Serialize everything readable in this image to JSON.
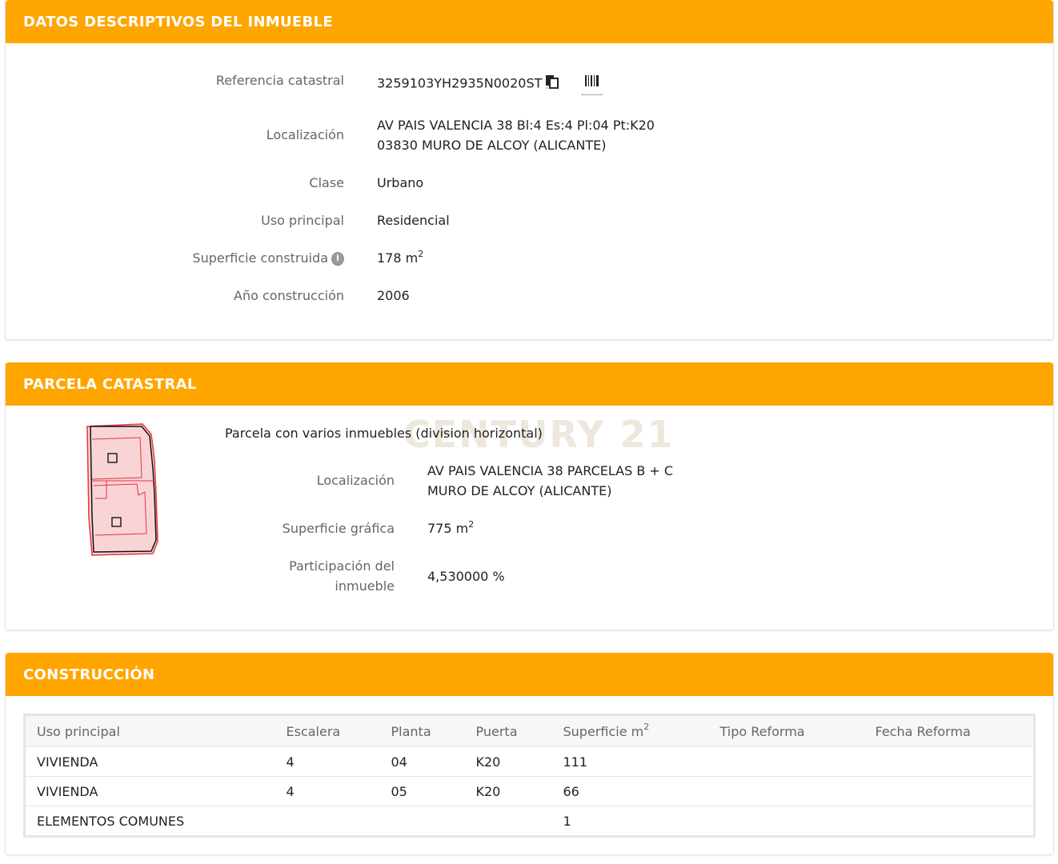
{
  "datos": {
    "title": "DATOS DESCRIPTIVOS DEL INMUEBLE",
    "referencia": {
      "label": "Referencia catastral",
      "value": "3259103YH2935N0020ST",
      "copy_icon": "copy-icon",
      "barcode_icon": "barcode-icon"
    },
    "localizacion": {
      "label": "Localización",
      "line1": "AV PAIS VALENCIA 38 Bl:4 Es:4 Pl:04 Pt:K20",
      "line2": "03830 MURO DE ALCOY (ALICANTE)"
    },
    "clase": {
      "label": "Clase",
      "value": "Urbano"
    },
    "uso": {
      "label": "Uso principal",
      "value": "Residencial"
    },
    "superficie": {
      "label": "Superficie construida",
      "value": "178 m",
      "unit_exp": "2",
      "info_icon": "info-icon"
    },
    "anio": {
      "label": "Año construcción",
      "value": "2006"
    }
  },
  "parcela": {
    "title": "PARCELA CATASTRAL",
    "subtitle": "Parcela con varios inmuebles (division horizontal)",
    "watermark": "CENTURY 21",
    "localizacion": {
      "label": "Localización",
      "line1": "AV PAIS VALENCIA 38 PARCELAS B + C",
      "line2": "MURO DE ALCOY (ALICANTE)"
    },
    "superficie": {
      "label": "Superficie gráfica",
      "value": "775 m",
      "unit_exp": "2"
    },
    "participacion": {
      "label_line1": "Participación del",
      "label_line2": "inmueble",
      "value": "4,530000 %"
    },
    "colors": {
      "outline": "#e8323c",
      "fill": "#f9d4d6"
    }
  },
  "construccion": {
    "title": "CONSTRUCCIÓN",
    "headers": [
      "Uso principal",
      "Escalera",
      "Planta",
      "Puerta",
      "Superficie m",
      "Tipo Reforma",
      "Fecha Reforma"
    ],
    "header_sup": "2",
    "rows": [
      [
        "VIVIENDA",
        "4",
        "04",
        "K20",
        "111",
        "",
        ""
      ],
      [
        "VIVIENDA",
        "4",
        "05",
        "K20",
        "66",
        "",
        ""
      ],
      [
        "ELEMENTOS COMUNES",
        "",
        "",
        "",
        "1",
        "",
        ""
      ]
    ]
  },
  "colors": {
    "accent": "#FFA500",
    "label_text": "#666666",
    "value_text": "#222222"
  }
}
